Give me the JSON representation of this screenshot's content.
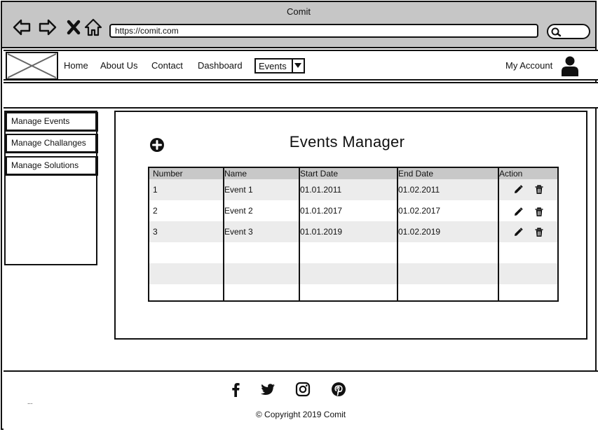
{
  "window": {
    "title": "Comit"
  },
  "browser": {
    "url": "https://comit.com"
  },
  "nav": {
    "links": [
      "Home",
      "About Us",
      "Contact",
      "Dashboard"
    ],
    "events_select": "Events",
    "account_label": "My Account"
  },
  "sidebar": {
    "items": [
      "Manage Events",
      "Manage Challanges",
      "Manage Solutions"
    ]
  },
  "main": {
    "title": "Events Manager",
    "table": {
      "headers": [
        "Number",
        "Name",
        "Start Date",
        "End Date",
        "Action"
      ],
      "rows": [
        [
          "1",
          "Event 1",
          "01.01.2011",
          "01.02.2011"
        ],
        [
          "2",
          "Event 2",
          "01.01.2017",
          "01.02.2017"
        ],
        [
          "3",
          "Event 3",
          "01.01.2019",
          "01.02.2019"
        ]
      ]
    }
  },
  "footer": {
    "copyright": "© Copyright 2019 Comit",
    "social_icons": [
      "facebook-icon",
      "twitter-icon",
      "instagram-icon",
      "pinterest-icon"
    ],
    "dots": "..."
  },
  "colors": {
    "chrome": "#c6c6c6",
    "table_header": "#c8c8c8",
    "row_alt": "#ececec"
  }
}
